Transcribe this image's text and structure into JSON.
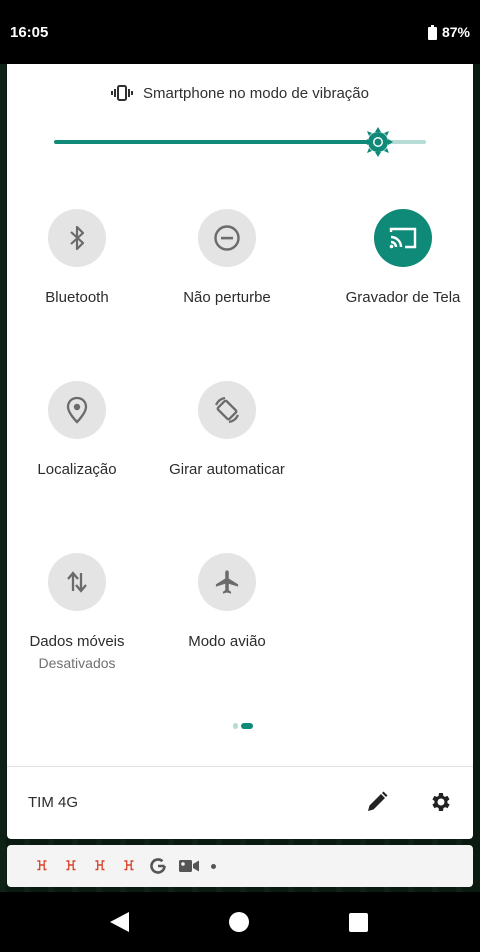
{
  "status_bar": {
    "time": "16:05",
    "battery_percent": "87%"
  },
  "quick_settings": {
    "vibration_text": "Smartphone no modo de vibração",
    "brightness_level": 0.87,
    "accent_color": "#0f8a78",
    "tiles": [
      {
        "label": "Bluetooth",
        "icon": "bluetooth-icon",
        "active": false
      },
      {
        "label": "Não perturbe",
        "icon": "do-not-disturb-icon",
        "active": false
      },
      {
        "label": "Gravador de Tela",
        "icon": "screen-cast-icon",
        "active": true
      },
      {
        "label": "Localização",
        "icon": "location-icon",
        "active": false
      },
      {
        "label": "Girar automaticar",
        "icon": "auto-rotate-icon",
        "active": false
      },
      {
        "label": "Dados móveis",
        "sublabel": "Desativados",
        "icon": "mobile-data-icon",
        "active": false
      },
      {
        "label": "Modo avião",
        "icon": "airplane-icon",
        "active": false
      }
    ],
    "page_indicator": {
      "pages": 2,
      "current": 2
    }
  },
  "footer": {
    "carrier": "TIM 4G",
    "edit_icon": "pencil-icon",
    "settings_icon": "gear-icon"
  },
  "notification_strip": {
    "app_glyph": "ꖾ",
    "glyph_color": "#d9442a",
    "icons": [
      "app-icon",
      "app-icon",
      "app-icon",
      "app-icon",
      "google-icon",
      "video-camera-icon",
      "dot-icon"
    ]
  },
  "nav_bar": {
    "buttons": [
      "back-icon",
      "home-icon",
      "recents-icon"
    ]
  }
}
